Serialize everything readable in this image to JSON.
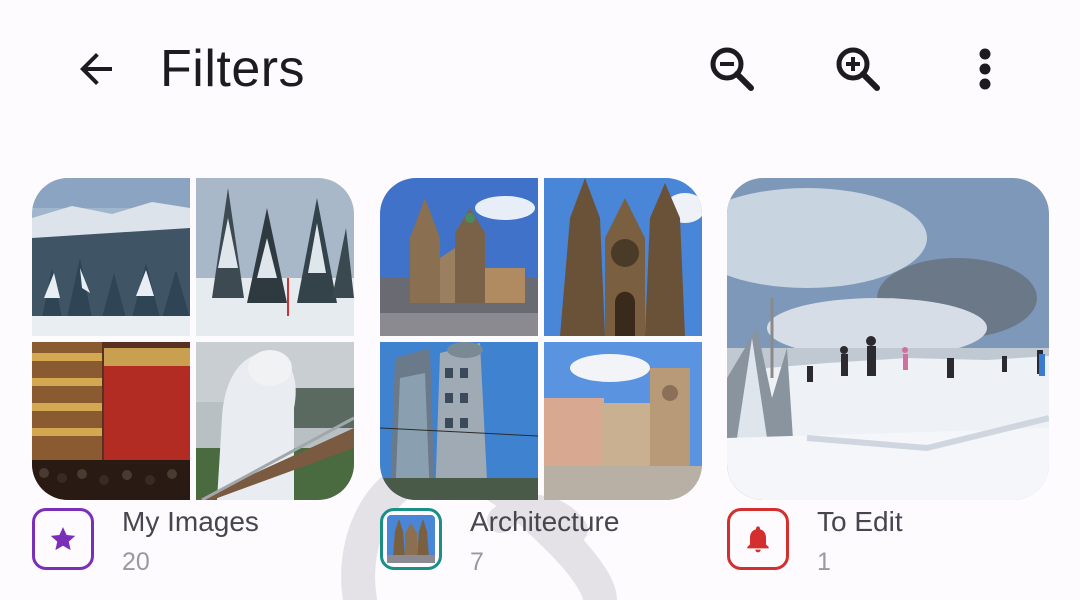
{
  "app_bar": {
    "title": "Filters",
    "back_icon": "arrow-back-icon",
    "actions": [
      "zoom-out-icon",
      "zoom-in-icon",
      "more-vert-icon"
    ]
  },
  "albums": [
    {
      "name": "My Images",
      "count": "20",
      "badge_icon": "star-icon",
      "badge_color": "#7b2fb8"
    },
    {
      "name": "Architecture",
      "count": "7",
      "badge_icon": "architecture-thumbnail",
      "badge_color": "#1a8f87"
    },
    {
      "name": "To Edit",
      "count": "1",
      "badge_icon": "bell-icon",
      "badge_color": "#d32f2f"
    }
  ],
  "colors": {
    "background": "#fdfbfd",
    "title_text": "#1d1b20",
    "secondary_text": "#9a98a0"
  }
}
